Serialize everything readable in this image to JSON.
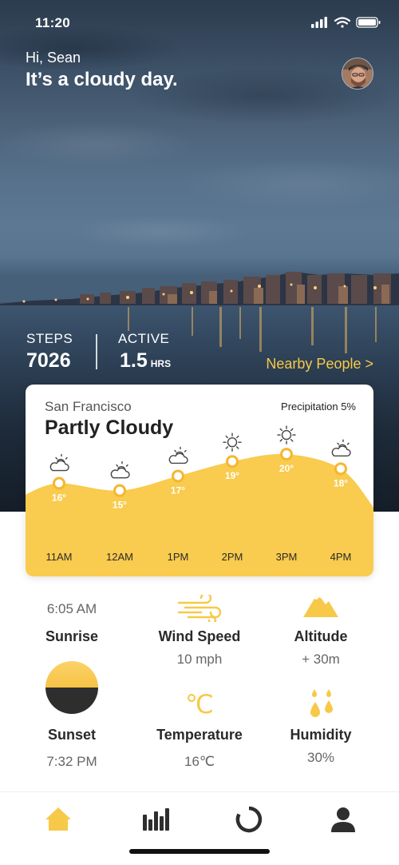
{
  "status_bar": {
    "time": "11:20"
  },
  "header": {
    "greeting": "Hi, Sean",
    "headline": "It’s a cloudy day."
  },
  "stats": {
    "steps_label": "STEPS",
    "steps_value": "7026",
    "active_label": "ACTIVE",
    "active_value": "1.5",
    "active_unit": "HRS",
    "nearby_link": "Nearby People >"
  },
  "weather_card": {
    "city": "San Francisco",
    "condition": "Partly Cloudy",
    "precipitation": "Precipitation 5%"
  },
  "chart_data": {
    "type": "area",
    "categories": [
      "11AM",
      "12AM",
      "1PM",
      "2PM",
      "3PM",
      "4PM"
    ],
    "values": [
      16,
      15,
      17,
      19,
      20,
      18
    ],
    "value_labels": [
      "16°",
      "15°",
      "17°",
      "19°",
      "20°",
      "18°"
    ],
    "icons": [
      "partly-cloudy-icon",
      "partly-cloudy-icon",
      "partly-cloudy-icon",
      "sun-icon",
      "sun-icon",
      "partly-cloudy-icon"
    ],
    "ylim": [
      12,
      21
    ],
    "fill_color": "#f9cb4e"
  },
  "details": {
    "sunrise_time": "6:05 AM",
    "sunrise_label": "Sunrise",
    "sunset_label": "Sunset",
    "sunset_time": "7:32 PM",
    "wind_label": "Wind Speed",
    "wind_value": "10 mph",
    "temperature_label": "Temperature",
    "temperature_value": "16℃",
    "celsius_symbol": "℃",
    "altitude_label": "Altitude",
    "altitude_value": "+ 30m",
    "humidity_label": "Humidity",
    "humidity_value": "30%"
  },
  "tabs": [
    "home-icon",
    "stats-icon",
    "activity-ring-icon",
    "profile-icon"
  ],
  "colors": {
    "accent": "#f7c948",
    "dark": "#2e2e2e"
  }
}
